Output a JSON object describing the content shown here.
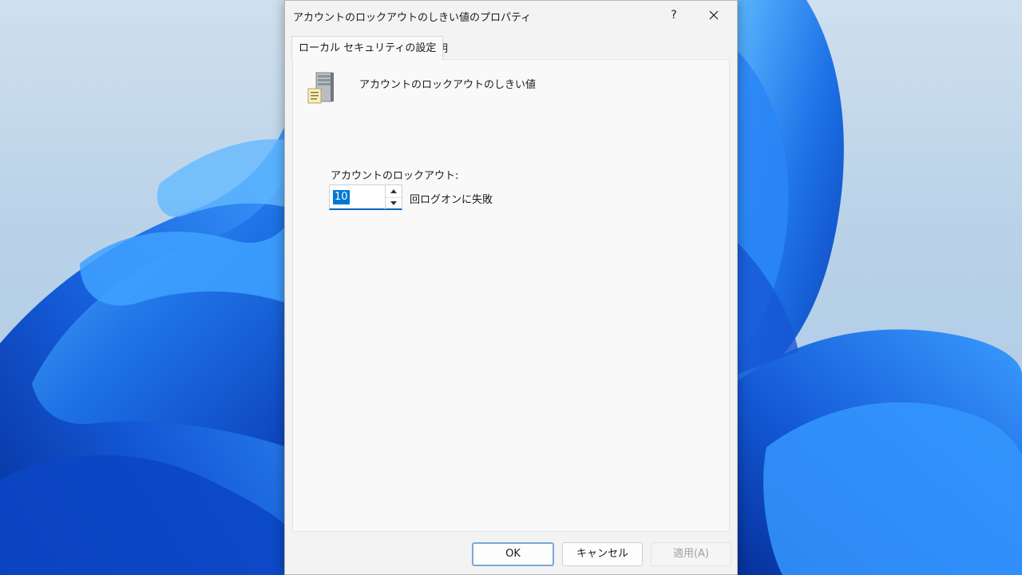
{
  "window": {
    "title": "アカウントのロックアウトのしきい値のプロパティ",
    "help_label": "?"
  },
  "tabs": [
    {
      "label": "ローカル セキュリティの設定",
      "active": true
    },
    {
      "label": "説明",
      "active": false
    }
  ],
  "policy": {
    "name": "アカウントのロックアウトのしきい値",
    "icon": "server-policy-icon"
  },
  "lockout": {
    "label": "アカウントのロックアウト:",
    "value": "10",
    "unit_label": "回ログオンに失敗"
  },
  "buttons": {
    "ok": "OK",
    "cancel": "キャンセル",
    "apply": "適用(A)"
  },
  "colors": {
    "accent": "#0078d4",
    "wallpaper_blue": "#1e6fe0",
    "dialog_bg": "#f3f3f3"
  }
}
